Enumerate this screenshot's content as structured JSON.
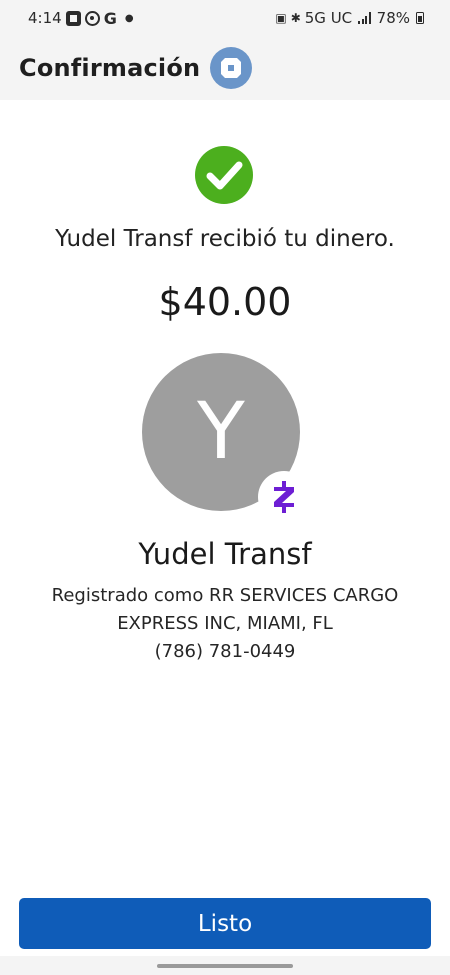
{
  "status_bar": {
    "time": "4:14",
    "google_letter": "G",
    "network": "5G UC",
    "battery": "78%",
    "icons": [
      "chase-app-icon",
      "notification-icon",
      "google-icon",
      "nfc-icon",
      "bluetooth-icon",
      "signal-icon",
      "battery-icon"
    ]
  },
  "header": {
    "title": "Confirmación",
    "logo": "chase-logo"
  },
  "confirmation": {
    "message": "Yudel Transf recibió tu dinero.",
    "amount": "$40.00"
  },
  "recipient": {
    "initial": "Y",
    "name": "Yudel Transf",
    "registered_as": "Registrado como RR SERVICES CARGO EXPRESS INC, MIAMI, FL",
    "phone": "(786) 781-0449"
  },
  "actions": {
    "done_label": "Listo"
  },
  "colors": {
    "success": "#4caf1e",
    "primary_button": "#0f5cb8",
    "zelle_purple": "#6d1ed4",
    "avatar_bg": "#9e9e9e",
    "chase_logo": "#6a95c9"
  }
}
